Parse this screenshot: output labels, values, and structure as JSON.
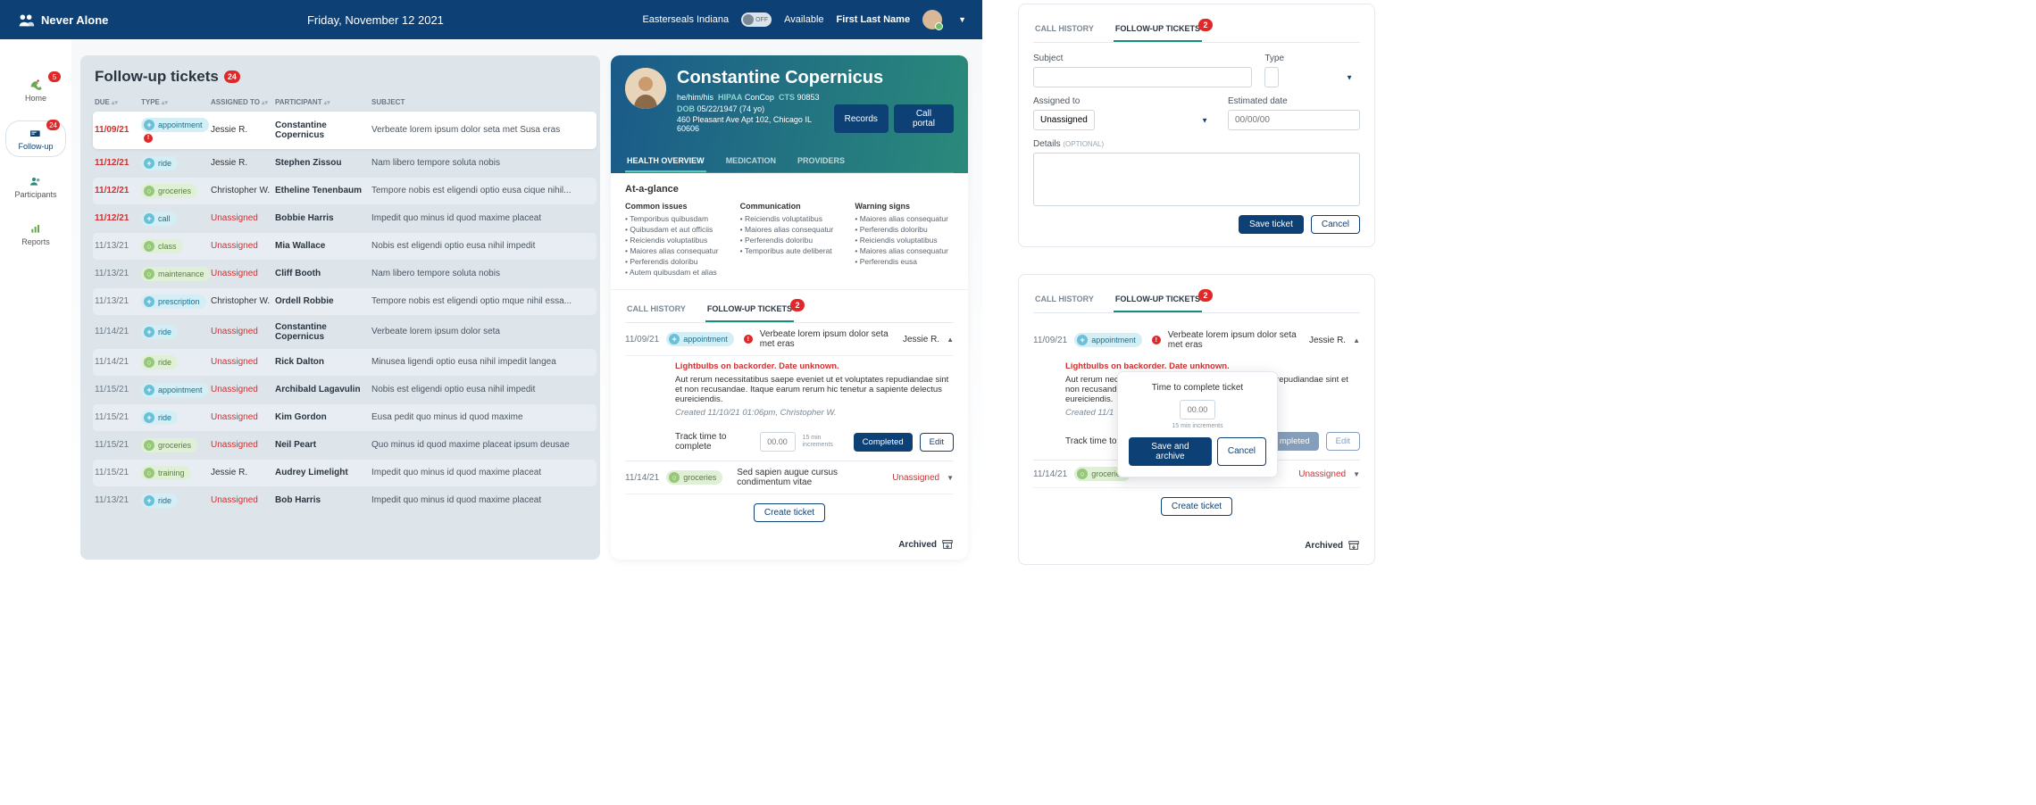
{
  "header": {
    "brand": "Never Alone",
    "date": "Friday, November 12 2021",
    "org": "Easterseals Indiana",
    "toggle_off": "OFF",
    "availability": "Available",
    "user_name": "First Last Name"
  },
  "nav": {
    "home": "Home",
    "home_badge": "5",
    "followup": "Follow-up",
    "followup_badge": "24",
    "participants": "Participants",
    "reports": "Reports"
  },
  "tickets": {
    "title": "Follow-up tickets",
    "badge": "24",
    "headers": {
      "due": "DUE",
      "type": "TYPE",
      "assigned": "ASSIGNED TO",
      "participant": "PARTICIPANT",
      "subject": "SUBJECT"
    },
    "rows": [
      {
        "date": "11/09/21",
        "date_red": true,
        "chip": "appointment",
        "chip_color": "blue",
        "chip_sym": "+",
        "alert": true,
        "assigned": "Jessie R.",
        "assigned_red": false,
        "participant": "Constantine Copernicus",
        "subject": "Verbeate lorem ipsum dolor seta met Susa eras",
        "white": true
      },
      {
        "date": "11/12/21",
        "date_red": true,
        "chip": "ride",
        "chip_color": "blue",
        "chip_sym": "+",
        "alert": false,
        "assigned": "Jessie R.",
        "assigned_red": false,
        "participant": "Stephen Zissou",
        "subject": "Nam libero tempore soluta nobis"
      },
      {
        "date": "11/12/21",
        "date_red": true,
        "chip": "groceries",
        "chip_color": "green",
        "chip_sym": "○",
        "alert": false,
        "assigned": "Christopher W.",
        "assigned_red": false,
        "participant": "Etheline Tenenbaum",
        "subject": "Tempore nobis est eligendi optio eusa cique nihil...",
        "alt": true
      },
      {
        "date": "11/12/21",
        "date_red": true,
        "chip": "call",
        "chip_color": "blue",
        "chip_sym": "+",
        "alert": false,
        "assigned": "Unassigned",
        "assigned_red": true,
        "participant": "Bobbie Harris",
        "subject": "Impedit quo minus id quod maxime placeat"
      },
      {
        "date": "11/13/21",
        "date_red": false,
        "chip": "class",
        "chip_color": "green",
        "chip_sym": "○",
        "alert": false,
        "assigned": "Unassigned",
        "assigned_red": true,
        "participant": "Mia Wallace",
        "subject": "Nobis est eligendi optio eusa nihil impedit",
        "alt": true
      },
      {
        "date": "11/13/21",
        "date_red": false,
        "chip": "maintenance",
        "chip_color": "green",
        "chip_sym": "○",
        "alert": false,
        "assigned": "Unassigned",
        "assigned_red": true,
        "participant": "Cliff Booth",
        "subject": "Nam libero tempore soluta nobis"
      },
      {
        "date": "11/13/21",
        "date_red": false,
        "chip": "prescription",
        "chip_color": "blue",
        "chip_sym": "+",
        "alert": false,
        "assigned": "Christopher W.",
        "assigned_red": false,
        "participant": "Ordell Robbie",
        "subject": "Tempore nobis est eligendi optio mque nihil essa...",
        "alt": true
      },
      {
        "date": "11/14/21",
        "date_red": false,
        "chip": "ride",
        "chip_color": "blue",
        "chip_sym": "+",
        "alert": false,
        "assigned": "Unassigned",
        "assigned_red": true,
        "participant": "Constantine Copernicus",
        "subject": "Verbeate lorem ipsum dolor seta"
      },
      {
        "date": "11/14/21",
        "date_red": false,
        "chip": "ride",
        "chip_color": "green",
        "chip_sym": "○",
        "alert": false,
        "assigned": "Unassigned",
        "assigned_red": true,
        "participant": "Rick Dalton",
        "subject": "Minusea ligendi optio eusa nihil impedit langea",
        "alt": true
      },
      {
        "date": "11/15/21",
        "date_red": false,
        "chip": "appointment",
        "chip_color": "blue",
        "chip_sym": "+",
        "alert": false,
        "assigned": "Unassigned",
        "assigned_red": true,
        "participant": "Archibald Lagavulin",
        "subject": "Nobis est eligendi optio eusa nihil impedit"
      },
      {
        "date": "11/15/21",
        "date_red": false,
        "chip": "ride",
        "chip_color": "blue",
        "chip_sym": "+",
        "alert": false,
        "assigned": "Unassigned",
        "assigned_red": true,
        "participant": "Kim Gordon",
        "subject": "Eusa pedit quo minus id quod maxime",
        "alt": true
      },
      {
        "date": "11/15/21",
        "date_red": false,
        "chip": "groceries",
        "chip_color": "green",
        "chip_sym": "○",
        "alert": false,
        "assigned": "Unassigned",
        "assigned_red": true,
        "participant": "Neil Peart",
        "subject": "Quo minus id quod maxime placeat ipsum deusae"
      },
      {
        "date": "11/15/21",
        "date_red": false,
        "chip": "training",
        "chip_color": "green",
        "chip_sym": "○",
        "alert": false,
        "assigned": "Jessie R.",
        "assigned_red": false,
        "participant": "Audrey Limelight",
        "subject": "Impedit quo minus id quod maxime placeat",
        "alt": true
      },
      {
        "date": "11/13/21",
        "date_red": false,
        "chip": "ride",
        "chip_color": "blue",
        "chip_sym": "+",
        "alert": false,
        "assigned": "Unassigned",
        "assigned_red": true,
        "participant": "Bob Harris",
        "subject": "Impedit quo minus id quod maxime placeat"
      }
    ]
  },
  "detail": {
    "name": "Constantine Copernicus",
    "pronouns": "he/him/his",
    "hipaa_label": "HIPAA",
    "hipaa_val": "ConCop",
    "cts_label": "CTS",
    "cts_val": "90853",
    "dob_label": "DOB",
    "dob_val": "05/22/1947 (74 yo)",
    "address": "460 Pleasant Ave Apt 102, Chicago IL 60606",
    "btn_records": "Records",
    "btn_call": "Call portal",
    "tab_health": "HEALTH OVERVIEW",
    "tab_med": "MEDICATION",
    "tab_prov": "PROVIDERS",
    "glance_title": "At-a-glance",
    "col1_title": "Common issues",
    "col1": [
      "Temporibus quibusdam",
      "Quibusdam et aut officiis",
      "Reiciendis voluptatibus",
      "Maiores alias consequatur",
      "Perferendis doloribu",
      "Autem quibusdam et alias"
    ],
    "col2_title": "Communication",
    "col2": [
      "Reiciendis voluptatibus",
      "Maiores alias consequatur",
      "Perferendis doloribu",
      "Temporibus aute deliberat"
    ],
    "col3_title": "Warning signs",
    "col3": [
      "Maiores alias consequatur",
      "Perferendis doloribu",
      "Reiciendis voluptatibus",
      "Maiores alias consequatur",
      "Perferendis eusa"
    ],
    "subtab_history": "CALL HISTORY",
    "subtab_tickets": "FOLLOW-UP TICKETS",
    "subtab_badge": "2",
    "t1_date": "11/09/21",
    "t1_chip": "appointment",
    "t1_subj": "Verbeate lorem ipsum dolor seta met eras",
    "t1_assigned": "Jessie R.",
    "t1_warn": "Lightbulbs on backorder. Date unknown.",
    "t1_body": "Aut rerum necessitatibus saepe eveniet ut et voluptates repudiandae sint et non recusandae. Itaque earum rerum hic tenetur a sapiente delectus eureiciendis.",
    "t1_created": "Created 11/10/21 01:06pm, Christopher W.",
    "track_label": "Track time to complete",
    "time_placeholder": "00.00",
    "time_hint": "15 min increments",
    "btn_completed": "Completed",
    "btn_edit": "Edit",
    "t2_date": "11/14/21",
    "t2_chip": "groceries",
    "t2_subj": "Sed sapien augue cursus condimentum vitae",
    "t2_assigned": "Unassigned",
    "create_ticket": "Create ticket",
    "archived": "Archived"
  },
  "form": {
    "tab_history": "CALL HISTORY",
    "tab_tickets": "FOLLOW-UP TICKETS",
    "badge": "2",
    "subject": "Subject",
    "type": "Type",
    "assigned": "Assigned to",
    "assigned_val": "Unassigned",
    "estimated": "Estimated date",
    "date_placeholder": "00/00/00",
    "details": "Details",
    "optional": "(OPTIONAL)",
    "save": "Save ticket",
    "cancel": "Cancel"
  },
  "popup": {
    "tab_history": "CALL HISTORY",
    "tab_tickets": "FOLLOW-UP TICKETS",
    "badge": "2",
    "t1_date": "11/09/21",
    "t1_chip": "appointment",
    "t1_subj": "Verbeate lorem ipsum dolor seta met eras",
    "t1_assigned": "Jessie R.",
    "t1_warn": "Lightbulbs on backorder. Date unknown.",
    "t1_body": "Aut rerum necessitatibus saepe eveniet ut et voluptates repudiandae sint et non recusandae. It                                                                                                     eureiciendis.",
    "t1_created": "Created 11/1",
    "track_label": "Track time to",
    "btn_completed": "mpleted",
    "btn_edit": "Edit",
    "pop_title": "Time to complete ticket",
    "time_placeholder": "00.00",
    "time_hint": "15 min increments",
    "save_archive": "Save and archive",
    "cancel": "Cancel",
    "t2_date": "11/14/21",
    "t2_chip": "groceries",
    "t2_assigned": "Unassigned",
    "create_ticket": "Create ticket",
    "archived": "Archived"
  }
}
